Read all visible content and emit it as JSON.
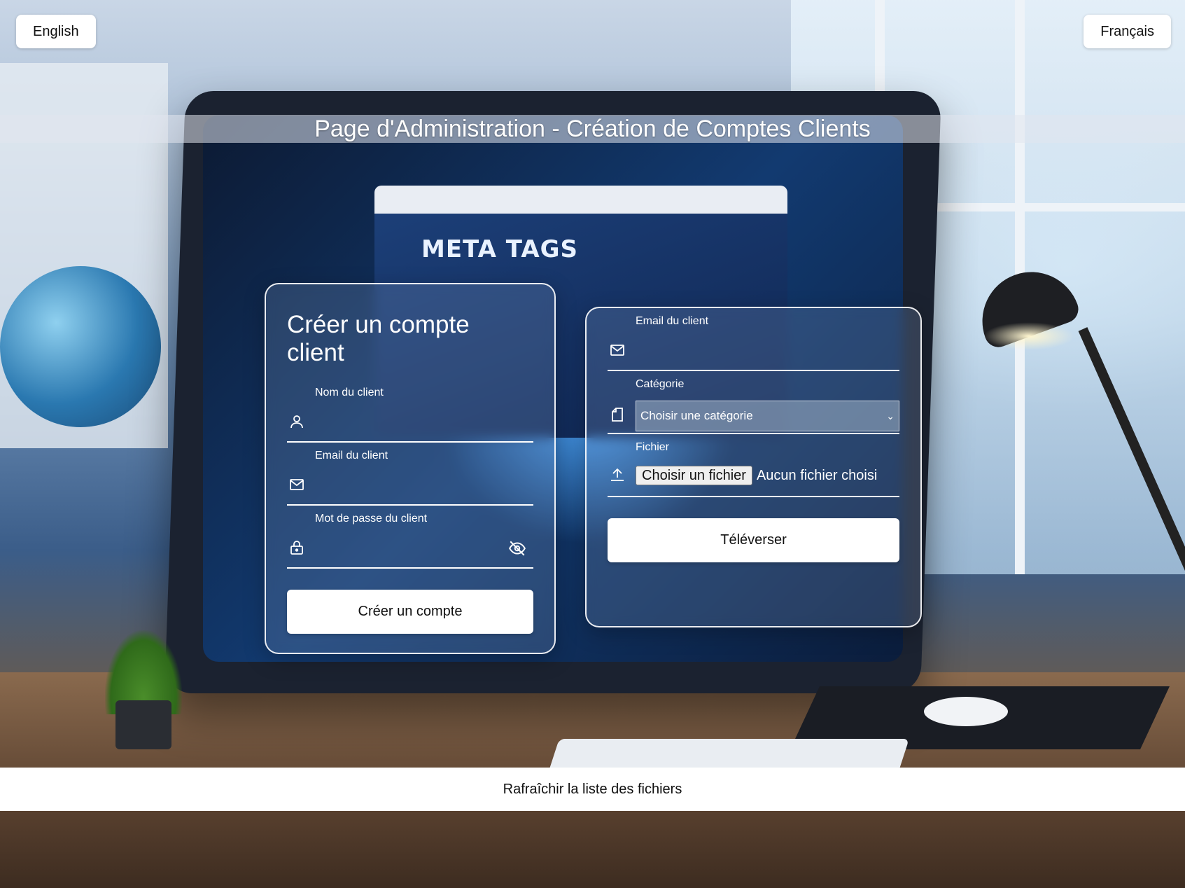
{
  "header": {
    "lang_english": "English",
    "lang_french": "Français",
    "title": "Page d'Administration - Création de Comptes Clients"
  },
  "background": {
    "screen_text": "META TAGS"
  },
  "create_account": {
    "title": "Créer un compte client",
    "name_label": "Nom du client",
    "name_value": "",
    "email_label": "Email du client",
    "email_value": "",
    "password_label": "Mot de passe du client",
    "password_value": "",
    "submit_label": "Créer un compte",
    "icons": [
      "user-icon",
      "mail-icon",
      "lock-icon",
      "eye-off-icon"
    ]
  },
  "upload": {
    "email_label": "Email du client",
    "email_value": "",
    "category_label": "Catégorie",
    "category_selected": "Choisir une catégorie",
    "file_label": "Fichier",
    "file_button": "Choisir un fichier",
    "file_status": "Aucun fichier choisi",
    "submit_label": "Téléverser",
    "icons": [
      "mail-icon",
      "folder-icon",
      "upload-icon"
    ]
  },
  "footer": {
    "refresh_label": "Rafraîchir la liste des fichiers"
  },
  "colors": {
    "card_border": "#ffffff",
    "button_bg": "#ffffff",
    "text": "#ffffff"
  }
}
